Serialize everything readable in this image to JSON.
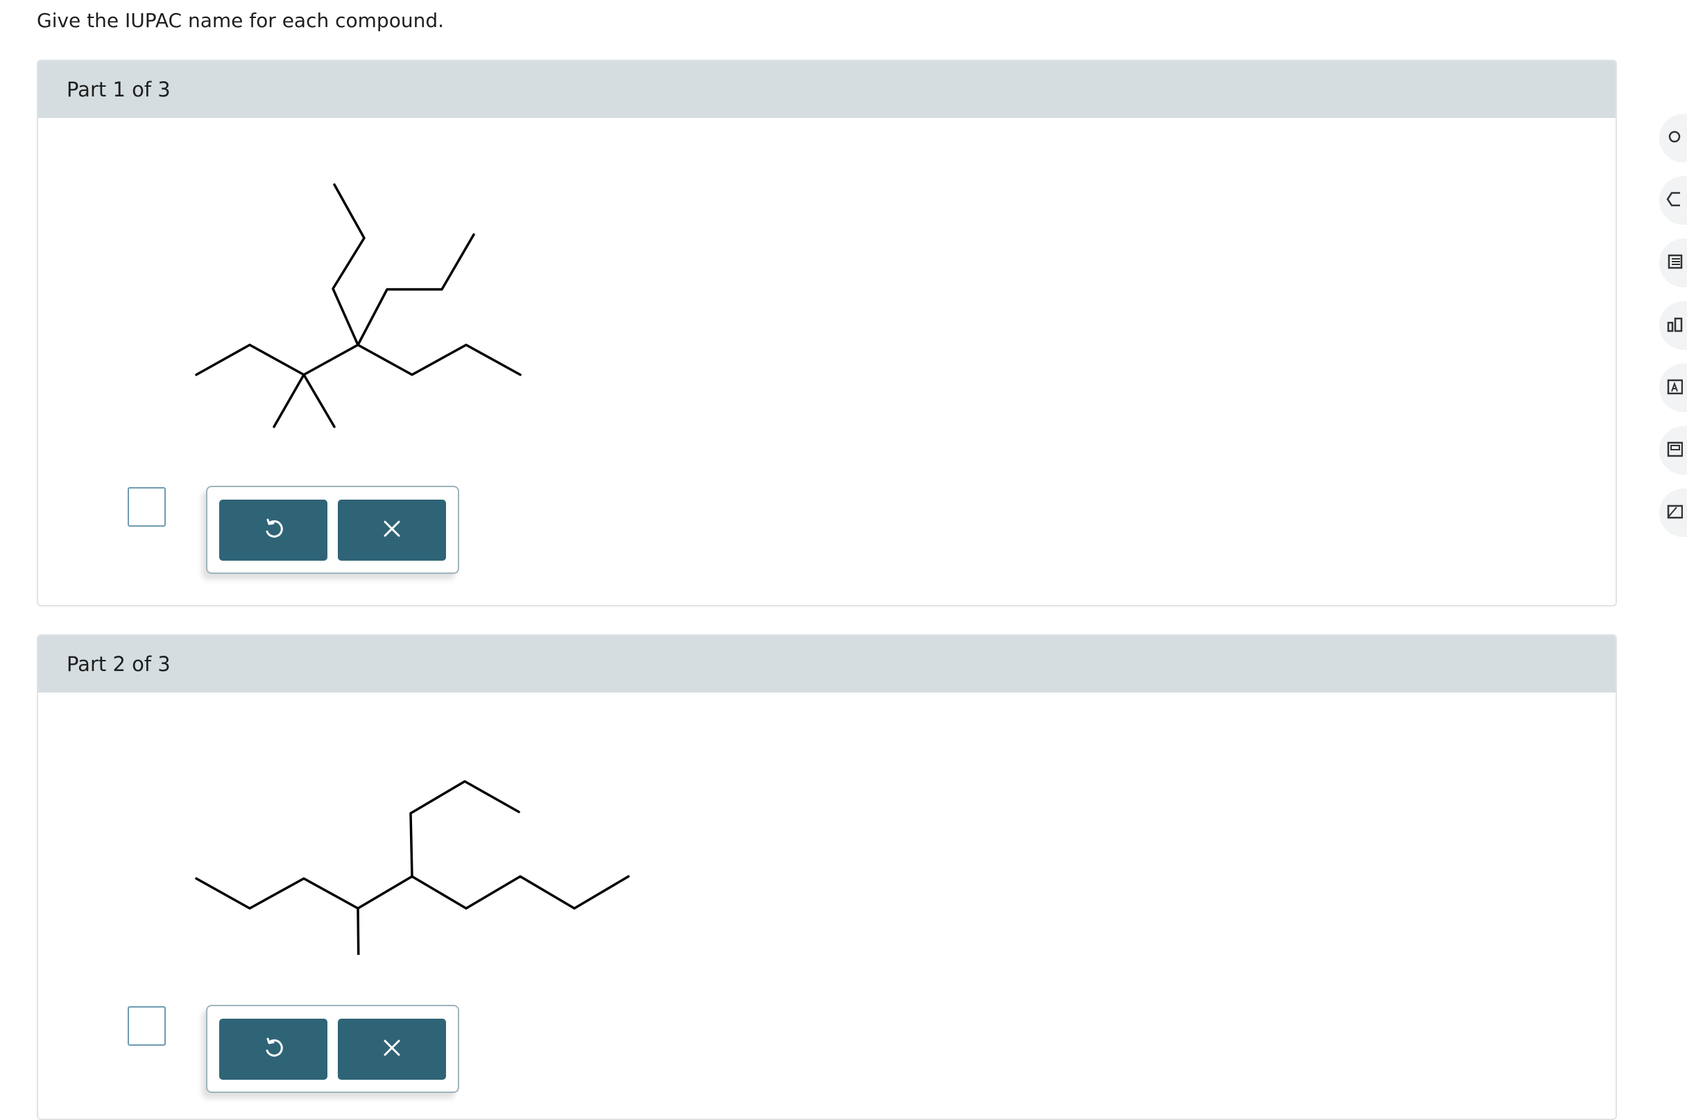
{
  "instructions": "Give the IUPAC name for each compound.",
  "parts": [
    {
      "title": "Part 1 of 3",
      "answer": ""
    },
    {
      "title": "Part 2 of 3",
      "answer": ""
    }
  ],
  "buttons": {
    "undo_icon": "undo-icon",
    "clear_icon": "close-icon"
  },
  "side_tools": [
    "hint-icon",
    "tag-icon",
    "notes-icon",
    "chart-icon",
    "glossary-icon",
    "book-icon",
    "message-icon"
  ],
  "colors": {
    "button": "#2f6476",
    "header": "#d5dde0",
    "answer_border": "#6f9ab0"
  }
}
